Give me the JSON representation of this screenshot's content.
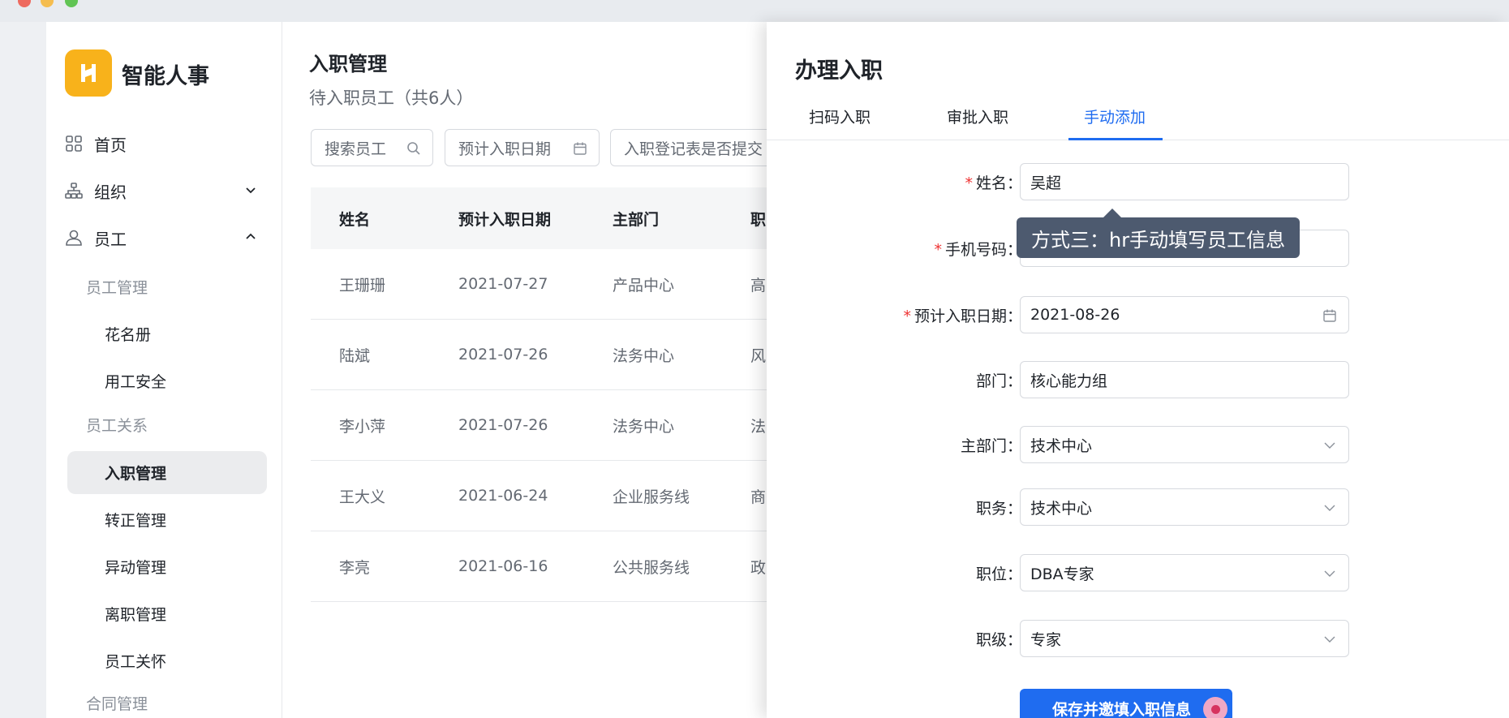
{
  "app": {
    "brand": "智能人事"
  },
  "nav": {
    "home": "首页",
    "org": "组织",
    "staff": "员工",
    "groups": {
      "staff_mgmt": "员工管理",
      "staff_relation": "员工关系",
      "contract": "合同管理"
    },
    "items": {
      "roster": "花名册",
      "safety": "用工安全",
      "onboarding": "入职管理",
      "regular": "转正管理",
      "transfer": "异动管理",
      "leave": "离职管理",
      "care": "员工关怀"
    },
    "active": "入职管理"
  },
  "main": {
    "title": "入职管理",
    "subtitle": "待入职员工（共6人）",
    "filters": {
      "search": "搜索员工",
      "date": "预计入职日期",
      "form": "入职登记表是否提交"
    },
    "table": {
      "headers": [
        "姓名",
        "预计入职日期",
        "主部门",
        "职"
      ],
      "rows": [
        [
          "王珊珊",
          "2021-07-27",
          "产品中心",
          "高"
        ],
        [
          "陆斌",
          "2021-07-26",
          "法务中心",
          "风"
        ],
        [
          "李小萍",
          "2021-07-26",
          "法务中心",
          "法"
        ],
        [
          "王大义",
          "2021-06-24",
          "企业服务线",
          "商"
        ],
        [
          "李亮",
          "2021-06-16",
          "公共服务线",
          "政"
        ]
      ]
    }
  },
  "drawer": {
    "title": "办理入职",
    "tabs": [
      "扫码入职",
      "审批入职",
      "手动添加"
    ],
    "active_tab": "手动添加",
    "tooltip": "方式三：hr手动填写员工信息",
    "fields": {
      "name": {
        "label": "姓名：",
        "value": "吴超",
        "required": true
      },
      "phone": {
        "label": "手机号码：",
        "value": "",
        "required": true
      },
      "date": {
        "label": "预计入职日期：",
        "value": "2021-08-26",
        "required": true
      },
      "dept": {
        "label": "部门：",
        "value": "核心能力组"
      },
      "main_dept": {
        "label": "主部门：",
        "value": "技术中心"
      },
      "duty": {
        "label": "职务：",
        "value": "技术中心"
      },
      "position": {
        "label": "职位：",
        "value": "DBA专家"
      },
      "level": {
        "label": "职级：",
        "value": "专家"
      }
    },
    "submit": "保存并邀填入职信息"
  },
  "colors": {
    "accent": "#1f6cf0",
    "brand": "#f8b21b",
    "required": "#e33333",
    "tooltip": "#4d5a6f"
  }
}
